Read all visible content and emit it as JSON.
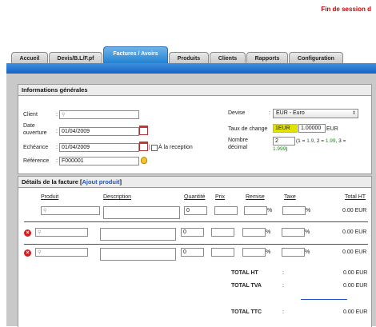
{
  "session_text": "Fin de session d",
  "tabs": [
    {
      "label": "Accueil",
      "active": false
    },
    {
      "label": "Devis/B.L/F.pf",
      "active": false
    },
    {
      "label": "Factures / Avoirs",
      "active": true
    },
    {
      "label": "Produits",
      "active": false
    },
    {
      "label": "Clients",
      "active": false
    },
    {
      "label": "Rapports",
      "active": false
    },
    {
      "label": "Configuration",
      "active": false
    }
  ],
  "info": {
    "title": "Informations générales",
    "client_label": "Client",
    "date_label_1": "Date",
    "date_label_2": "ouverture",
    "date_value": "01/04/2009",
    "echeance_label": "Echéance",
    "echeance_value": "01/04/2009",
    "reception_label": "À la reception",
    "reference_label": "Référence",
    "reference_value": "F000001",
    "devise_label": "Devise",
    "devise_value": "EUR - Euro",
    "taux_label": "Taux de change",
    "taux_code": "1EUR",
    "taux_value": "1.00000",
    "taux_unit": "EUR",
    "nombre_label_1": "Nombre",
    "nombre_label_2": "décimal",
    "nombre_value": "2",
    "hint_prefix": "(1 = ",
    "hint_v1": "1.9",
    "hint_mid1": ", 2 = ",
    "hint_v2": "1.99",
    "hint_mid2": ", 3 =",
    "hint_v3": "1.999",
    "hint_suffix": ")"
  },
  "details": {
    "title": "Détails de la facture",
    "bracket_open": "[",
    "add_link": "Ajout produit",
    "bracket_close": "]",
    "columns": [
      "Produit",
      "Description",
      "Quantité",
      "Prix",
      "Remise",
      "Taxe",
      "Total HT"
    ],
    "rows": [
      {
        "qty": "0",
        "total": "0.00 EUR",
        "deletable": false
      },
      {
        "qty": "0",
        "total": "0.00 EUR",
        "deletable": true
      },
      {
        "qty": "0",
        "total": "0.00 EUR",
        "deletable": true
      }
    ],
    "pct": "%",
    "totals": {
      "ht_label": "TOTAL HT",
      "ht_value": "0.00 EUR",
      "tva_label": "TOTAL TVA",
      "tva_value": "0.00 EUR",
      "ttc_label": "TOTAL TTC",
      "ttc_value": "0.00 EUR",
      "colon": ":"
    }
  },
  "colors": {
    "accent": "#1e7fd0",
    "session": "#cc0000",
    "highlight": "#e3e300"
  }
}
